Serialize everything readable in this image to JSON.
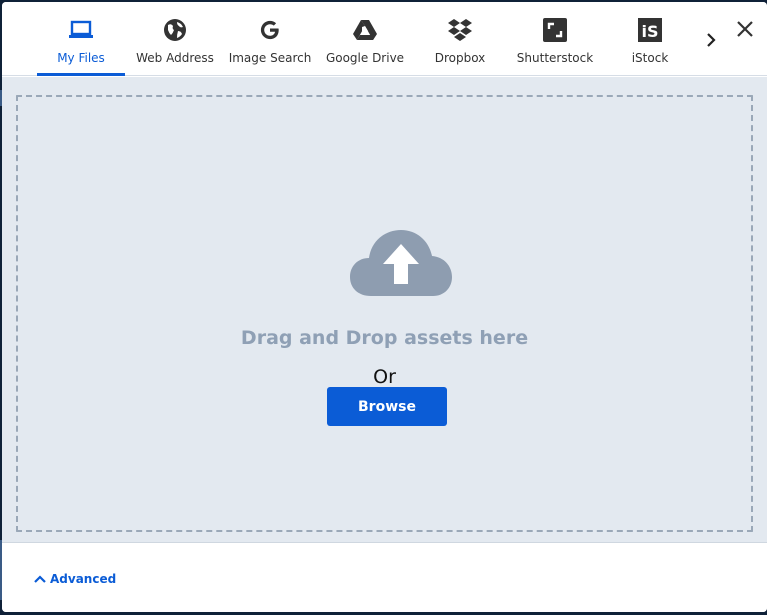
{
  "tabs": [
    {
      "label": "My Files",
      "icon": "laptop-icon",
      "active": true
    },
    {
      "label": "Web Address",
      "icon": "globe-icon"
    },
    {
      "label": "Image Search",
      "icon": "google-icon"
    },
    {
      "label": "Google Drive",
      "icon": "google-drive-icon"
    },
    {
      "label": "Dropbox",
      "icon": "dropbox-icon"
    },
    {
      "label": "Shutterstock",
      "icon": "shutterstock-icon"
    },
    {
      "label": "iStock",
      "icon": "istock-icon"
    }
  ],
  "istock_glyph": "iS",
  "drop_zone": {
    "message": "Drag and Drop assets here",
    "or_text": "Or",
    "browse_label": "Browse"
  },
  "footer": {
    "advanced_label": "Advanced"
  },
  "colors": {
    "accent": "#0b5cd6",
    "drop_bg": "#e3e9f0",
    "drop_text": "#8fa0b5",
    "cloud": "#8e9db0"
  }
}
